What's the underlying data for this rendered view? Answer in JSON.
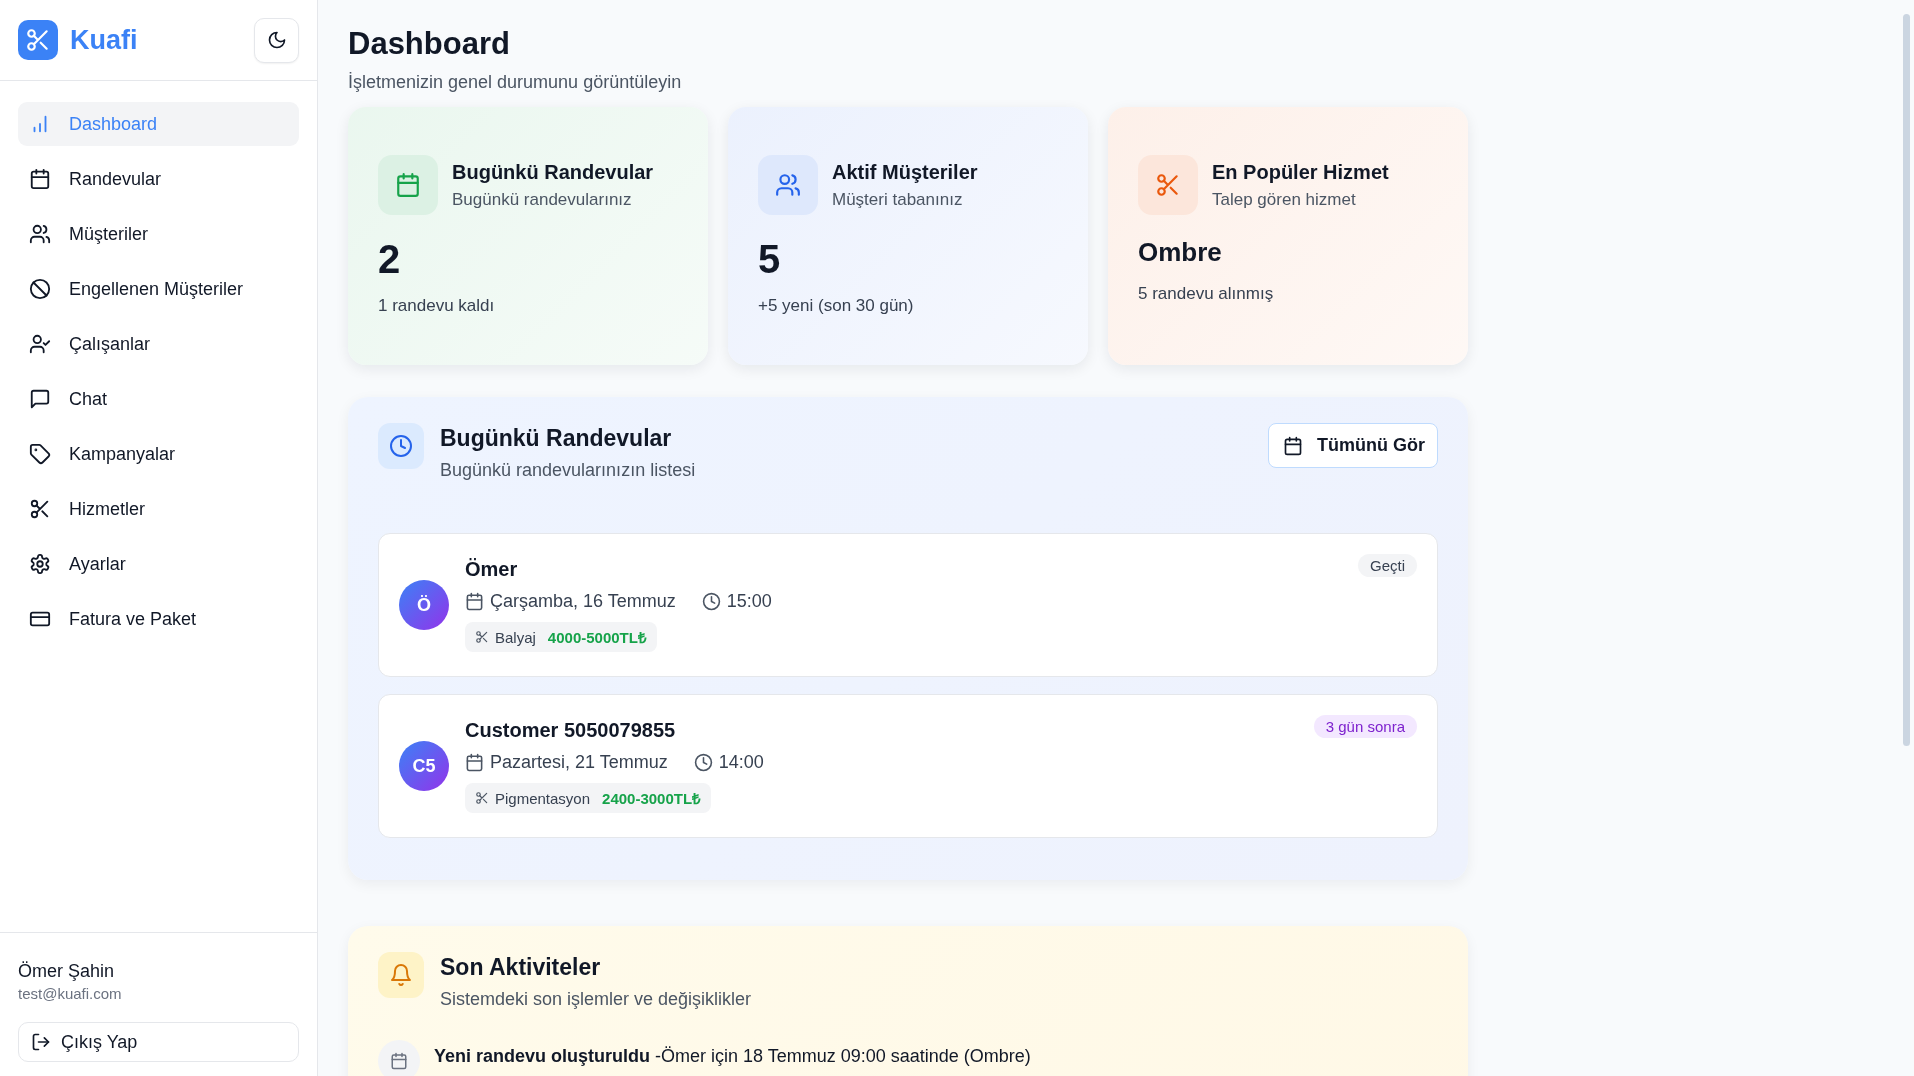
{
  "brand": {
    "name": "Kuafi"
  },
  "sidebar": {
    "items": [
      {
        "label": "Dashboard",
        "selected": true
      },
      {
        "label": "Randevular",
        "selected": false
      },
      {
        "label": "Müşteriler",
        "selected": false
      },
      {
        "label": "Engellenen Müşteriler",
        "selected": false
      },
      {
        "label": "Çalışanlar",
        "selected": false
      },
      {
        "label": "Chat",
        "selected": false
      },
      {
        "label": "Kampanyalar",
        "selected": false
      },
      {
        "label": "Hizmetler",
        "selected": false
      },
      {
        "label": "Ayarlar",
        "selected": false
      },
      {
        "label": "Fatura ve Paket",
        "selected": false
      }
    ]
  },
  "user": {
    "name": "Ömer Şahin",
    "email": "test@kuafi.com"
  },
  "logout": {
    "label": "Çıkış Yap"
  },
  "page": {
    "title": "Dashboard",
    "subtitle": "İşletmenizin genel durumunu görüntüleyin"
  },
  "stats": [
    {
      "kind": "count",
      "title": "Bugünkü Randevular",
      "subtitle": "Bugünkü randevularınız",
      "value": "2",
      "note": "1 randevu kaldı",
      "color": "#16a34a"
    },
    {
      "kind": "count",
      "title": "Aktif Müşteriler",
      "subtitle": "Müşteri tabanınız",
      "value": "5",
      "note": "+5 yeni (son 30 gün)",
      "color": "#2563eb"
    },
    {
      "kind": "service",
      "title": "En Popüler Hizmet",
      "subtitle": "Talep gören hizmet",
      "value": "Ombre",
      "note": "5 randevu alınmış",
      "color": "#ea580c"
    }
  ],
  "appointments_panel": {
    "title": "Bugünkü Randevular",
    "subtitle": "Bugünkü randevularınızın listesi",
    "button": "Tümünü Gör",
    "appointments": [
      {
        "kind": "past",
        "initials": "Ö",
        "name": "Ömer",
        "date": "Çarşamba, 16 Temmuz",
        "time": "15:00",
        "service": "Balyaj",
        "price": "4000-5000TL₺",
        "badge": "Geçti"
      },
      {
        "kind": "upcoming",
        "initials": "C5",
        "name": "Customer 5050079855",
        "date": "Pazartesi, 21 Temmuz",
        "time": "14:00",
        "service": "Pigmentasyon",
        "price": "2400-3000TL₺",
        "badge": "3 gün sonra"
      }
    ]
  },
  "activities_panel": {
    "title": "Son Aktiviteler",
    "subtitle": "Sistemdeki son işlemler ve değişiklikler",
    "activities": [
      {
        "text": "**Yeni randevu oluşturuldu** -Ömer için 18 Temmuz 09:00 saatinde (Ombre)"
      }
    ]
  }
}
